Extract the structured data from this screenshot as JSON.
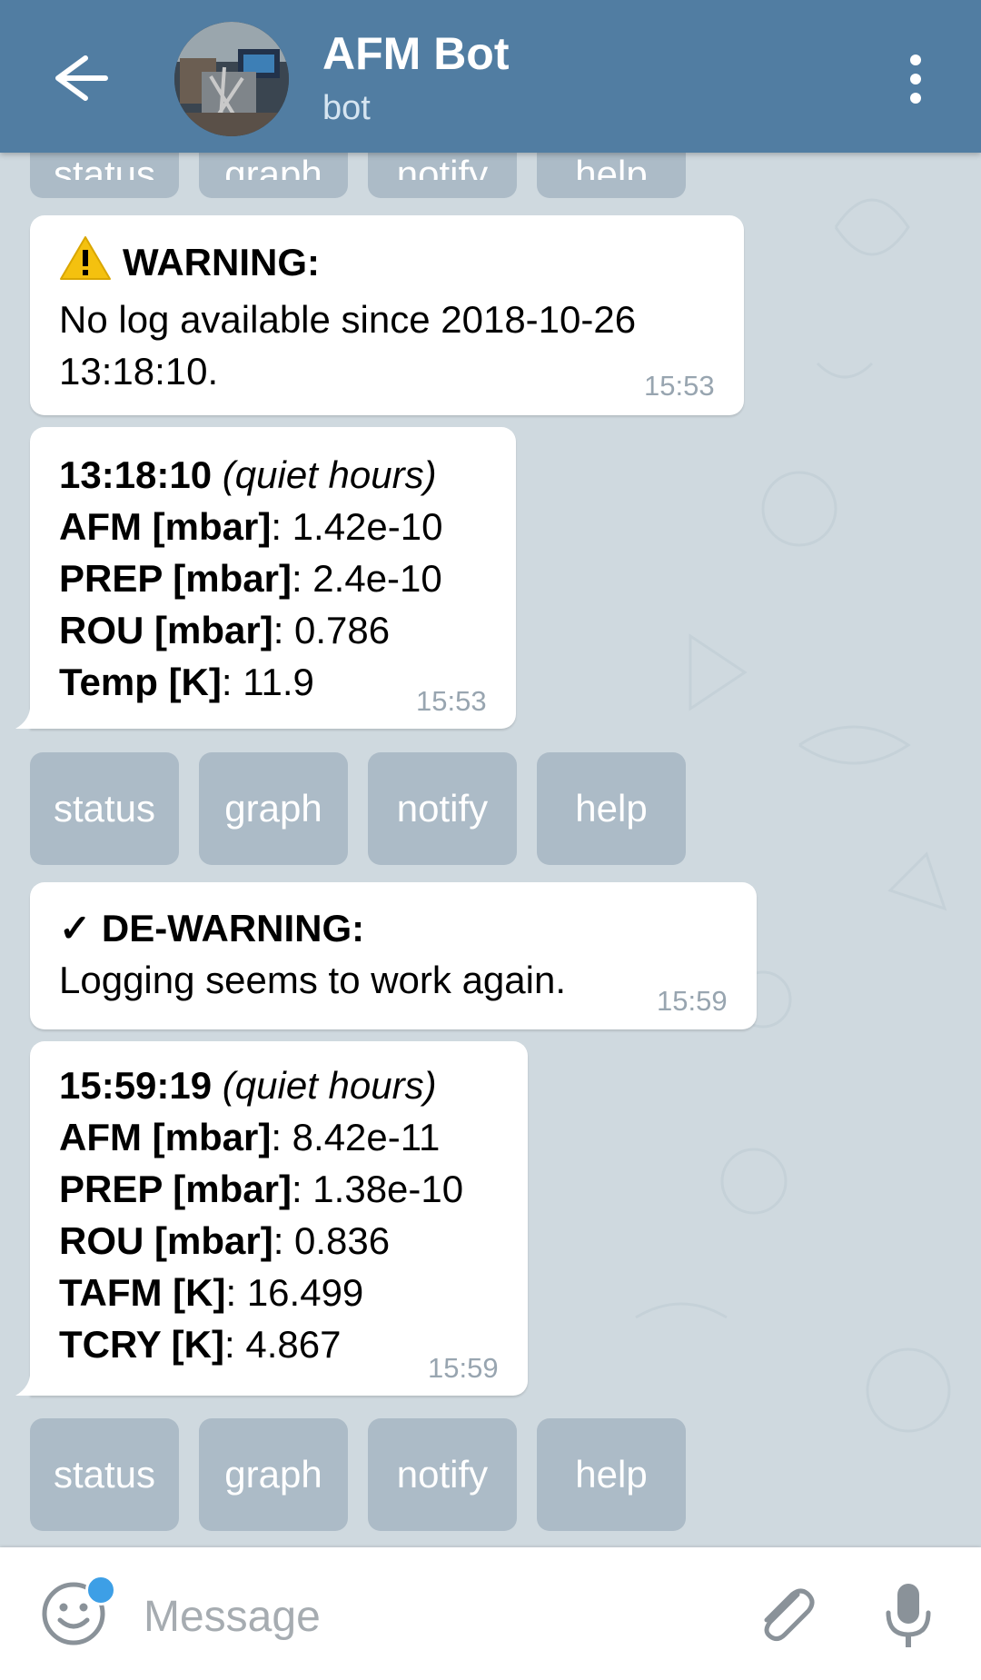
{
  "header": {
    "title": "AFM Bot",
    "subtitle": "bot",
    "back_icon": "arrow-left-icon",
    "menu_icon": "more-vertical-icon"
  },
  "messages": [
    {
      "type": "warning",
      "icon": "warning-triangle-icon",
      "heading": "WARNING:",
      "lines": [
        "No log available since 2018-10-26",
        "13:18:10."
      ],
      "time": "15:53"
    },
    {
      "type": "status",
      "timestamp": "13:18:10",
      "note": "(quiet hours)",
      "rows": [
        {
          "label": "AFM [mbar]",
          "value": ": 1.42e-10"
        },
        {
          "label": "PREP [mbar]",
          "value": ": 2.4e-10"
        },
        {
          "label": "ROU [mbar]",
          "value": ": 0.786"
        },
        {
          "label": "Temp [K]",
          "value": ": 11.9"
        }
      ],
      "time": "15:53"
    },
    {
      "type": "dewarning",
      "icon": "checkmark-icon",
      "heading": "✓ DE-WARNING:",
      "lines": [
        "Logging seems to work again."
      ],
      "time": "15:59"
    },
    {
      "type": "status",
      "timestamp": "15:59:19",
      "note": "(quiet hours)",
      "rows": [
        {
          "label": "AFM [mbar]",
          "value": ": 8.42e-11"
        },
        {
          "label": "PREP [mbar]",
          "value": ": 1.38e-10"
        },
        {
          "label": "ROU [mbar]",
          "value": ": 0.836"
        },
        {
          "label": "TAFM [K]",
          "value": ": 16.499"
        },
        {
          "label": "TCRY [K]",
          "value": ": 4.867"
        }
      ],
      "time": "15:59"
    }
  ],
  "keyboard": {
    "buttons": [
      "status",
      "graph",
      "notify",
      "help"
    ]
  },
  "input": {
    "placeholder": "Message",
    "emoji_icon": "smiley-icon",
    "attach_icon": "paperclip-icon",
    "mic_icon": "microphone-icon"
  },
  "colors": {
    "header": "#517da2",
    "wallpaper": "#cfd9df",
    "bubble": "#ffffff",
    "time": "#98a5b0",
    "keyboard_button": "#8fa3b2",
    "badge": "#3d9fe6"
  }
}
